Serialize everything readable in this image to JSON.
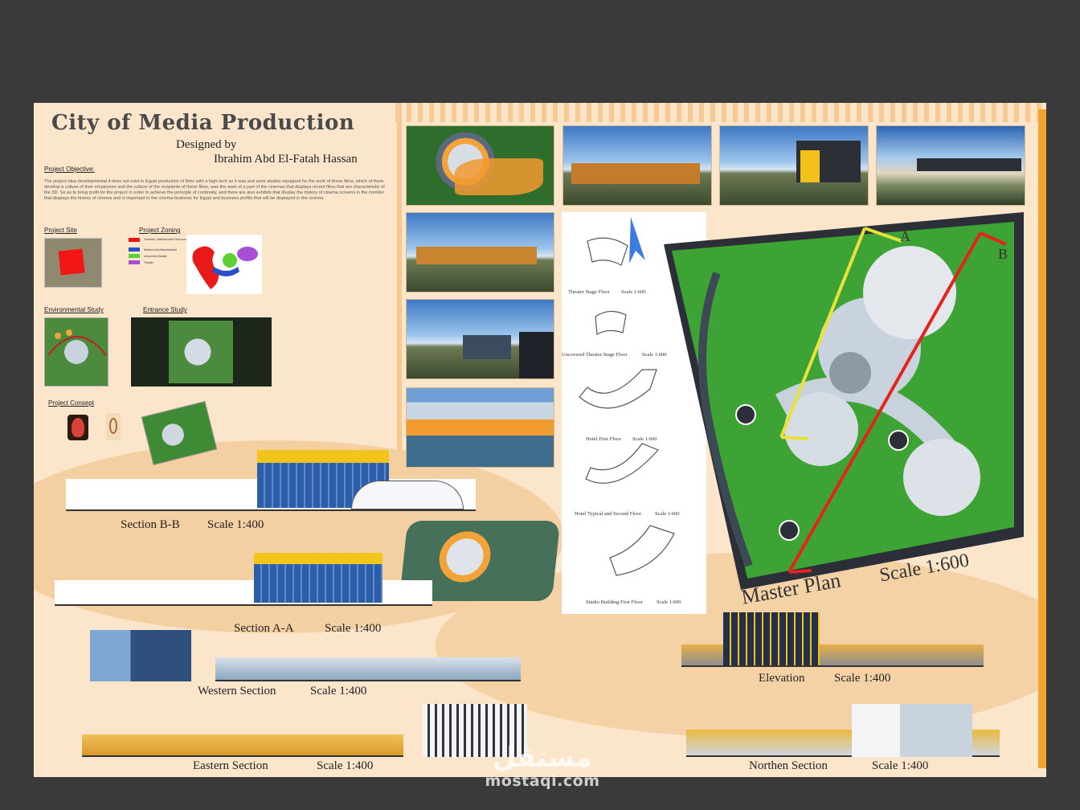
{
  "poster": {
    "title": "City of Media Production",
    "designed_by": "Designed by",
    "designer": "Ibrahim Abd El-Fatah Hassan",
    "objective_heading": "Project Objective:",
    "objective_text": "The project idea developmental it does not exist in Egypt production of films with a high-tech so it was and work studios equipped for the work of these films, which of them develop a culture of their employees and the culture of the recipients of these films, was the work of a part of the cinemas that displays recent films that are characteristic of the 3D. So as to bring profit for the project in order to achieve the principle of continuity, and there are also exhibits that display the history of cinema screens in the corridor that displays the history of cinema and is important in the cinema business for Egypt and business profile that will be displayed in the cinema",
    "project_site": "Project Site",
    "project_zoning": "Project Zoning",
    "zoning_legend": [
      {
        "label": "Cinemas, Galleries and Food court",
        "color": "#e8141a"
      },
      {
        "label": "Studios and Administrative",
        "color": "#2a4ec9"
      },
      {
        "label": "Uncovered theater",
        "color": "#5fd032"
      },
      {
        "label": "Theater",
        "color": "#a94fd6"
      }
    ],
    "environmental_study": "Environmental Study",
    "entrance_study": "Entrance Study",
    "project_consept": "Project Consept"
  },
  "sections": {
    "section_bb": "Section B-B",
    "section_bb_scale": "Scale 1:400",
    "section_aa": "Section A-A",
    "section_aa_scale": "Scale 1:400",
    "western": "Western Section",
    "western_scale": "Scale 1:400",
    "eastern": "Eastern Section",
    "eastern_scale": "Scale 1:400",
    "elevation": "Elevation",
    "elevation_scale": "Scale 1:400",
    "northen": "Northen Section",
    "northen_scale": "Scale 1:400"
  },
  "plans": {
    "theater_stage": "Theater Stage Floor",
    "theater_stage_scale": "Scale 1:600",
    "uncovered_theater": "Uncovered  Theater Stage Floor",
    "uncovered_theater_scale": "Scale 1:600",
    "hotel_first": "Hotel First Floor",
    "hotel_first_scale": "Scale 1:600",
    "hotel_typical": "Hotel Typical and Second Floor",
    "hotel_typical_scale": "Scale 1:600",
    "studio_first": "Studio Building First Floor",
    "studio_first_scale": "Scale 1:600"
  },
  "master_plan": {
    "label": "Master Plan",
    "scale": "Scale 1:600",
    "marker_a": "A",
    "marker_b": "B"
  },
  "watermark": {
    "arabic": "مستقل",
    "latin": "mostaqi.com"
  }
}
